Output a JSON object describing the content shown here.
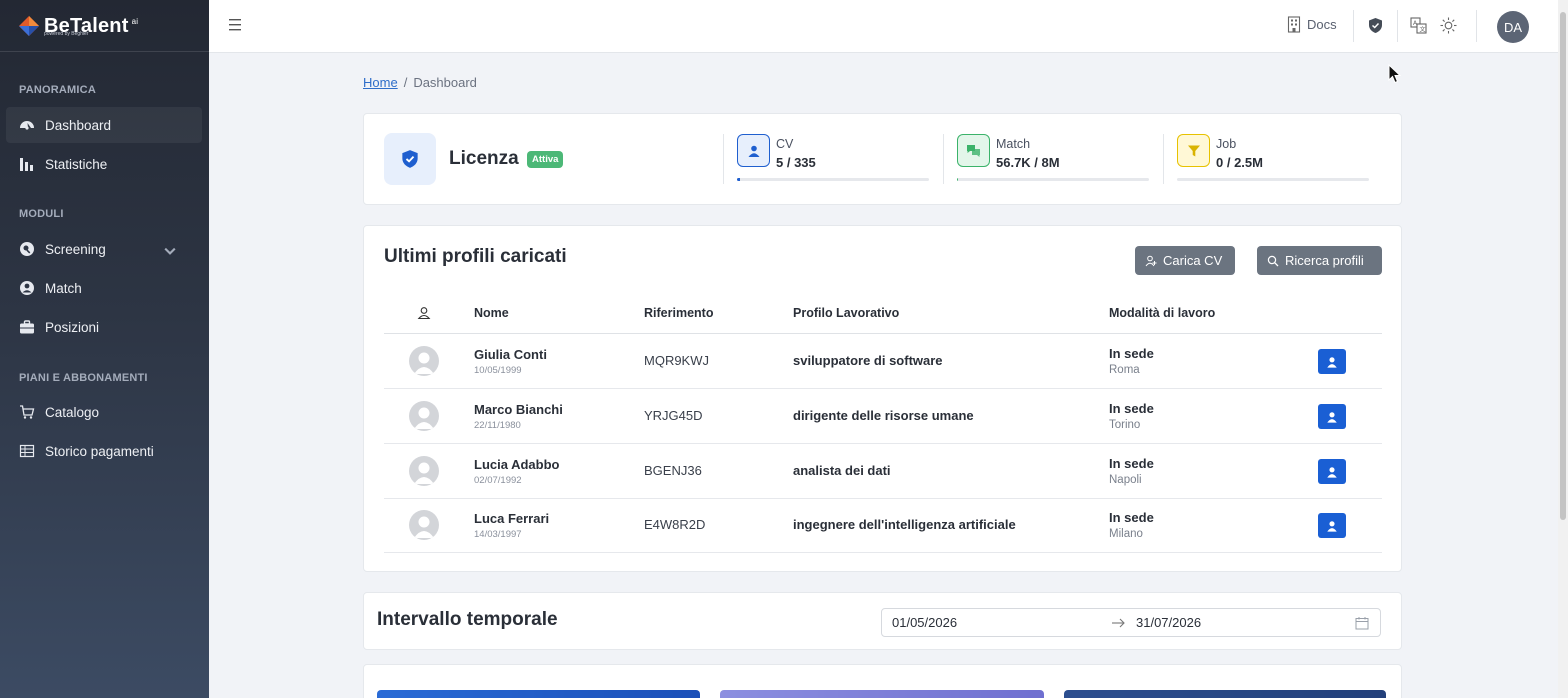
{
  "brand": {
    "name": "BeTalent",
    "sup": "ai",
    "tagline": "powered by Beghler"
  },
  "sidebar": {
    "sections": [
      {
        "title": "PANORAMICA"
      },
      {
        "title": "MODULI"
      },
      {
        "title": "PIANI E ABBONAMENTI"
      }
    ],
    "items": [
      {
        "label": "Dashboard",
        "icon": "dashboard-icon",
        "active": true
      },
      {
        "label": "Statistiche",
        "icon": "bar-chart-icon"
      },
      {
        "label": "Screening",
        "icon": "screening-icon"
      },
      {
        "label": "Match",
        "icon": "user-circle-icon"
      },
      {
        "label": "Posizioni",
        "icon": "briefcase-icon"
      },
      {
        "label": "Catalogo",
        "icon": "cart-icon"
      },
      {
        "label": "Storico pagamenti",
        "icon": "table-icon"
      }
    ]
  },
  "topbar": {
    "docs_label": "Docs",
    "avatar_initials": "DA"
  },
  "breadcrumb": {
    "home": "Home",
    "current": "Dashboard"
  },
  "license": {
    "title": "Licenza",
    "badge": "Attiva",
    "stats": [
      {
        "label": "CV",
        "value": "5 / 335",
        "progress": 0.015,
        "color": "#1f5fcf",
        "bg": "#e7effc"
      },
      {
        "label": "Match",
        "value": "56.7K / 8M",
        "progress": 0.007,
        "color": "#3bb36a",
        "bg": "#e3f6ea"
      },
      {
        "label": "Job",
        "value": "0 / 2.5M",
        "progress": 0,
        "color": "#e7c200",
        "bg": "#fff8d6"
      }
    ]
  },
  "profiles": {
    "title": "Ultimi profili caricati",
    "upload_label": "Carica CV",
    "search_label": "Ricerca profili",
    "columns": [
      "Nome",
      "Riferimento",
      "Profilo Lavorativo",
      "Modalità di lavoro"
    ],
    "rows": [
      {
        "name": "Giulia Conti",
        "date": "10/05/1999",
        "ref": "MQR9KWJ",
        "profile": "sviluppatore di software",
        "mode": "In sede",
        "city": "Roma"
      },
      {
        "name": "Marco Bianchi",
        "date": "22/11/1980",
        "ref": "YRJG45D",
        "profile": "dirigente delle risorse umane",
        "mode": "In sede",
        "city": "Torino"
      },
      {
        "name": "Lucia Adabbo",
        "date": "02/07/1992",
        "ref": "BGENJ36",
        "profile": "analista dei dati",
        "mode": "In sede",
        "city": "Napoli"
      },
      {
        "name": "Luca Ferrari",
        "date": "14/03/1997",
        "ref": "E4W8R2D",
        "profile": "ingegnere dell'intelligenza artificiale",
        "mode": "In sede",
        "city": "Milano"
      }
    ]
  },
  "interval": {
    "title": "Intervallo temporale",
    "start": "01/05/2026",
    "end": "31/07/2026"
  }
}
